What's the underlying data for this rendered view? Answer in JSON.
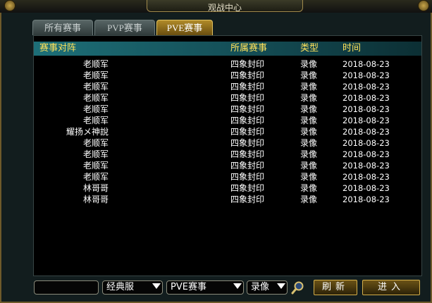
{
  "window": {
    "title": "观战中心"
  },
  "tabs": [
    {
      "label": "所有赛事",
      "active": false
    },
    {
      "label": "PVP赛事",
      "active": false
    },
    {
      "label": "PVE赛事",
      "active": true
    }
  ],
  "table": {
    "headers": [
      "赛事对阵",
      "所属赛事",
      "类型",
      "时间"
    ],
    "rows": [
      {
        "team": "老顺军",
        "event": "四象封印",
        "type": "录像",
        "time": "2018-08-23"
      },
      {
        "team": "老顺军",
        "event": "四象封印",
        "type": "录像",
        "time": "2018-08-23"
      },
      {
        "team": "老顺军",
        "event": "四象封印",
        "type": "录像",
        "time": "2018-08-23"
      },
      {
        "team": "老顺军",
        "event": "四象封印",
        "type": "录像",
        "time": "2018-08-23"
      },
      {
        "team": "老顺军",
        "event": "四象封印",
        "type": "录像",
        "time": "2018-08-23"
      },
      {
        "team": "老顺军",
        "event": "四象封印",
        "type": "录像",
        "time": "2018-08-23"
      },
      {
        "team": "耀扬メ神說",
        "event": "四象封印",
        "type": "录像",
        "time": "2018-08-23"
      },
      {
        "team": "老顺军",
        "event": "四象封印",
        "type": "录像",
        "time": "2018-08-23"
      },
      {
        "team": "老顺军",
        "event": "四象封印",
        "type": "录像",
        "time": "2018-08-23"
      },
      {
        "team": "老顺军",
        "event": "四象封印",
        "type": "录像",
        "time": "2018-08-23"
      },
      {
        "team": "老顺军",
        "event": "四象封印",
        "type": "录像",
        "time": "2018-08-23"
      },
      {
        "team": "林哥哥",
        "event": "四象封印",
        "type": "录像",
        "time": "2018-08-23"
      },
      {
        "team": "林哥哥",
        "event": "四象封印",
        "type": "录像",
        "time": "2018-08-23"
      }
    ]
  },
  "controls": {
    "search_value": "",
    "server_select": "经典服",
    "event_select": "PVE赛事",
    "type_select": "录像",
    "refresh_label": "刷新",
    "enter_label": "进入"
  },
  "icons": {
    "search": "magnifier-icon"
  },
  "colors": {
    "header_text": "#ffe25a",
    "accent_gold": "#d6b04a",
    "header_bg": "#1d6f78"
  }
}
